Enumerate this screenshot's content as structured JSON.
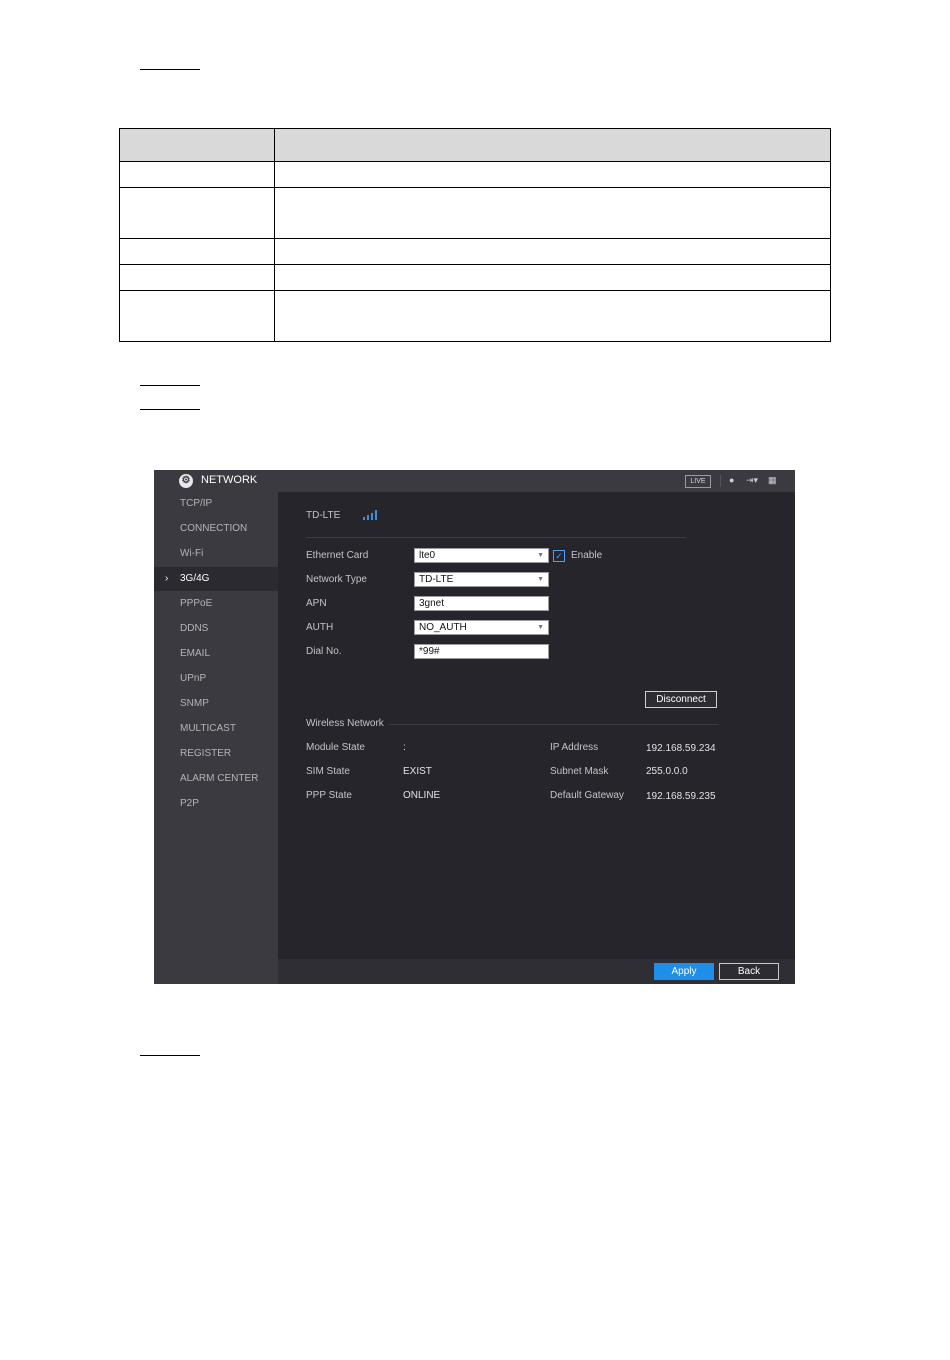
{
  "app": {
    "title": "NETWORK",
    "live_badge": "LIVE",
    "toolbar_icons": [
      "user-icon",
      "logout-icon",
      "grid-icon"
    ]
  },
  "sidebar": {
    "items": [
      {
        "label": "TCP/IP"
      },
      {
        "label": "CONNECTION"
      },
      {
        "label": "Wi-Fi"
      },
      {
        "label": "3G/4G",
        "active": true
      },
      {
        "label": "PPPoE"
      },
      {
        "label": "DDNS"
      },
      {
        "label": "EMAIL"
      },
      {
        "label": "UPnP"
      },
      {
        "label": "SNMP"
      },
      {
        "label": "MULTICAST"
      },
      {
        "label": "REGISTER"
      },
      {
        "label": "ALARM CENTER"
      },
      {
        "label": "P2P"
      }
    ],
    "active_arrow": "›"
  },
  "main": {
    "network_name": "TD-LTE",
    "signal_level": 4,
    "signal_color": "#3c8fe0",
    "form": {
      "ethernet_card_label": "Ethernet Card",
      "ethernet_card_value": "lte0",
      "enable_label": "Enable",
      "enable_checked": "✓",
      "network_type_label": "Network Type",
      "network_type_value": "TD-LTE",
      "apn_label": "APN",
      "apn_value": "3gnet",
      "auth_label": "AUTH",
      "auth_value": "NO_AUTH",
      "dial_label": "Dial No.",
      "dial_value": "*99#",
      "dropdown_caret": "▼"
    },
    "disconnect_label": "Disconnect",
    "wireless": {
      "section_title": "Wireless Network",
      "module_state_label": "Module State",
      "module_state_value": ":",
      "sim_state_label": "SIM State",
      "sim_state_value": "EXIST",
      "ppp_state_label": "PPP State",
      "ppp_state_value": "ONLINE",
      "ip_label": "IP Address",
      "ip_value": "192.168.59.234",
      "mask_label": "Subnet Mask",
      "mask_value": "255.0.0.0",
      "gateway_label": "Default Gateway",
      "gateway_value": "192.168.59.235"
    },
    "apply_label": "Apply",
    "back_label": "Back",
    "accent_color": "#1e8ee8"
  }
}
